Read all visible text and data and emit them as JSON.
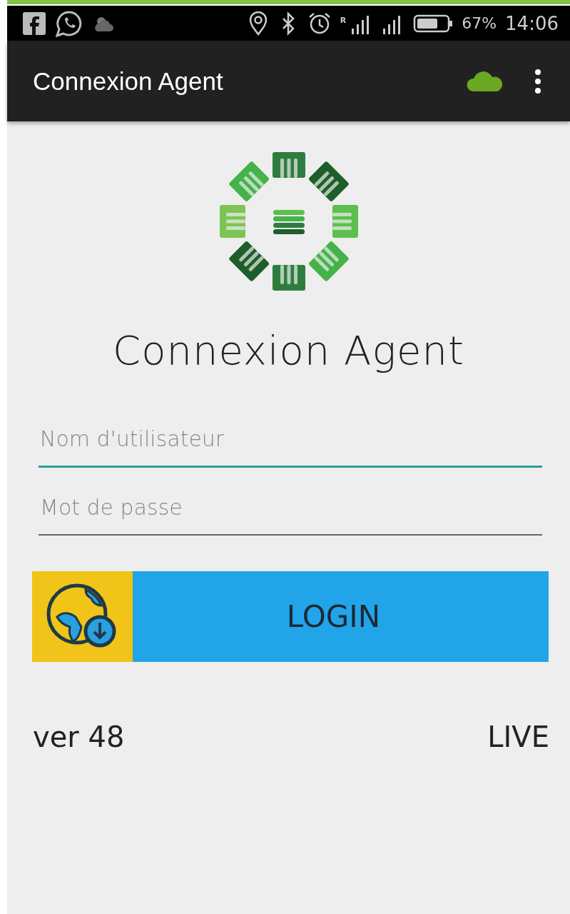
{
  "status_bar": {
    "roaming": "R",
    "battery": "67%",
    "time": "14:06"
  },
  "app_bar": {
    "title": "Connexion Agent"
  },
  "heading": "Connexion Agent",
  "fields": [
    {
      "placeholder": "Nom d'utilisateur",
      "focused": true
    },
    {
      "placeholder": "Mot de passe",
      "focused": false
    }
  ],
  "login_button": {
    "label": "LOGIN"
  },
  "footer": {
    "version": "ver 48",
    "environment": "LIVE"
  }
}
